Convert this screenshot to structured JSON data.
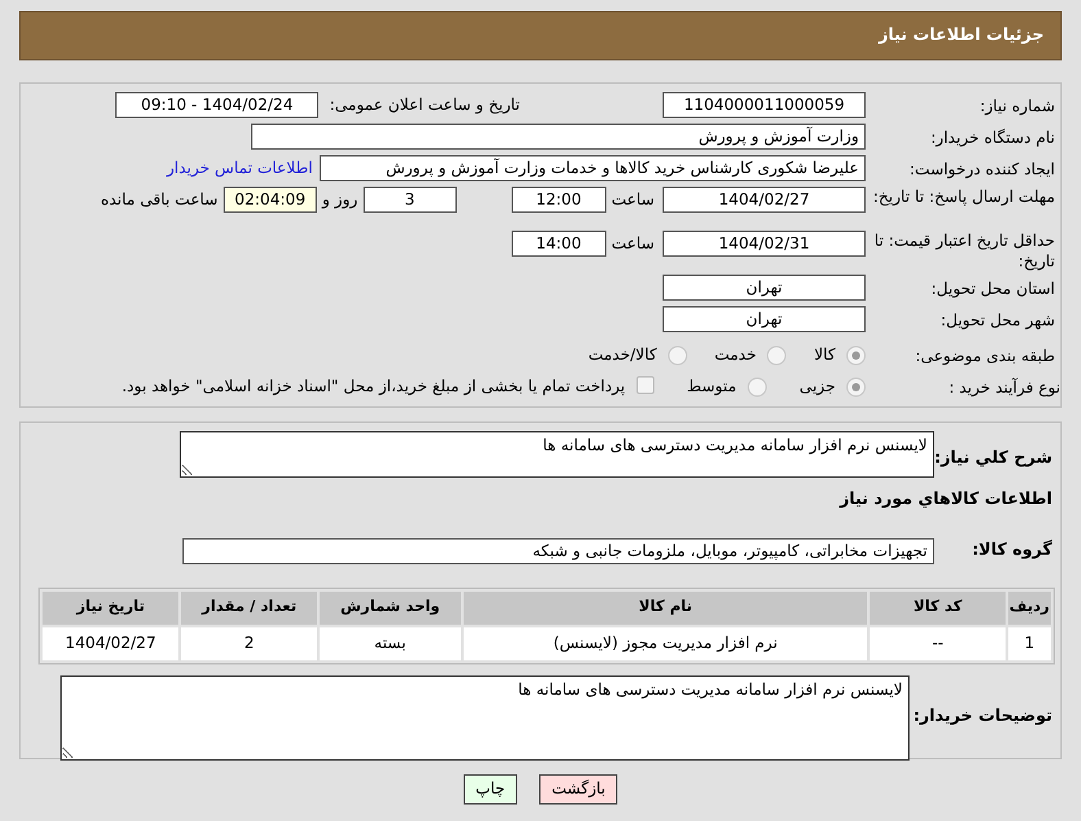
{
  "header": {
    "title": "جزئیات اطلاعات نیاز"
  },
  "details": [
    {
      "label": "شماره نیاز:",
      "items": [
        {
          "kind": "field",
          "value": "1104000011000059"
        },
        {
          "kind": "text",
          "text": "تاریخ و ساعت اعلان عمومی:"
        },
        {
          "kind": "field",
          "value": "1404/02/24 - 09:10"
        }
      ]
    },
    {
      "label": "نام دستگاه خریدار:",
      "items": [
        {
          "kind": "field",
          "value": "وزارت آموزش و پرورش"
        }
      ]
    },
    {
      "label": "ایجاد کننده درخواست:",
      "items": [
        {
          "kind": "field",
          "value": "علیرضا شکوری کارشناس خرید کالاها و خدمات وزارت آموزش و پرورش"
        },
        {
          "kind": "link",
          "text": "اطلاعات تماس خریدار"
        }
      ]
    },
    {
      "label": "مهلت ارسال پاسخ: تا تاریخ:",
      "items": [
        {
          "kind": "field",
          "value": "1404/02/27"
        },
        {
          "kind": "text",
          "text": "ساعت"
        },
        {
          "kind": "field",
          "value": "12:00"
        },
        {
          "kind": "field",
          "value": "3"
        },
        {
          "kind": "text",
          "text": "روز و"
        },
        {
          "kind": "timer",
          "value": "02:04:09"
        },
        {
          "kind": "text",
          "text": "ساعت باقی مانده"
        }
      ]
    },
    {
      "label": "حداقل تاریخ اعتبار قیمت: تا تاریخ:",
      "items": [
        {
          "kind": "field",
          "value": "1404/02/31"
        },
        {
          "kind": "text",
          "text": "ساعت"
        },
        {
          "kind": "field",
          "value": "14:00"
        }
      ]
    },
    {
      "label": "استان محل تحویل:",
      "items": [
        {
          "kind": "field",
          "value": "تهران"
        }
      ]
    },
    {
      "label": "شهر محل تحویل:",
      "items": [
        {
          "kind": "field",
          "value": "تهران"
        }
      ]
    },
    {
      "label": "طبقه بندی موضوعی:",
      "items": [
        {
          "kind": "radio",
          "text": "کالا",
          "selected": true
        },
        {
          "kind": "radio",
          "text": "خدمت",
          "selected": false
        },
        {
          "kind": "radio",
          "text": "کالا/خدمت",
          "selected": false
        }
      ]
    },
    {
      "label": "نوع فرآیند خرید :",
      "items": [
        {
          "kind": "radio",
          "text": "جزیی",
          "selected": true
        },
        {
          "kind": "radio",
          "text": "متوسط",
          "selected": false
        },
        {
          "kind": "checkbox",
          "text": "پرداخت تمام یا بخشی از مبلغ خرید،از محل \"اسناد خزانه اسلامی\" خواهد بود.",
          "checked": false
        }
      ]
    }
  ],
  "description": {
    "label": "شرح کلي نیاز:",
    "value": "لایسنس نرم افزار سامانه مدیریت دسترسی های سامانه ها"
  },
  "goods_title": "اطلاعات کالاهاي مورد نیاز",
  "goods_group": {
    "label": "گروه کالا:",
    "value": "تجهیزات مخابراتی، کامپیوتر، موبایل، ملزومات جانبی و شبکه"
  },
  "table": {
    "columns": [
      "ردیف",
      "کد کالا",
      "نام کالا",
      "واحد شمارش",
      "تعداد / مقدار",
      "تاریخ نیاز"
    ],
    "rows": [
      [
        "1",
        "--",
        "نرم افزار مدیریت مجوز (لایسنس)",
        "بسته",
        "2",
        "1404/02/27"
      ]
    ]
  },
  "buyer_notes": {
    "label": "توضیحات خریدار:",
    "value": "لایسنس نرم افزار سامانه مدیریت دسترسی های سامانه ها"
  },
  "buttons": [
    {
      "kind": "back",
      "label": "بازگشت"
    },
    {
      "kind": "print",
      "label": "چاپ"
    }
  ]
}
